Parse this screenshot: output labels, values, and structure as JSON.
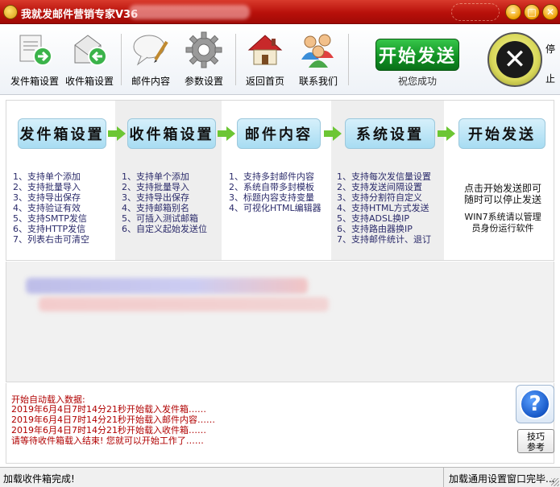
{
  "window": {
    "title": "我就发邮件营销专家V36",
    "buttons": {
      "minimize": "–",
      "maximize": "□",
      "close": "✕"
    }
  },
  "toolbar": {
    "items": [
      {
        "label": "发件箱设置",
        "icon": "sender-envelope-icon"
      },
      {
        "label": "收件箱设置",
        "icon": "inbox-envelope-icon"
      },
      {
        "label": "邮件内容",
        "icon": "speech-bubble-pen-icon"
      },
      {
        "label": "参数设置",
        "icon": "gear-icon"
      },
      {
        "label": "返回首页",
        "icon": "home-icon"
      },
      {
        "label": "联系我们",
        "icon": "people-icon"
      }
    ],
    "start": {
      "label": "开始发送",
      "subtitle": "祝您成功"
    },
    "stop": {
      "label_top": "停",
      "label_bottom": "止",
      "icon": "x-icon"
    }
  },
  "flow": {
    "steps": [
      {
        "title": "发件箱设置",
        "items": [
          "1、支持单个添加",
          "2、支持批量导入",
          "3、支持导出保存",
          "4、支持验证有效",
          "5、支持SMTP发信",
          "6、支持HTTP发信",
          "7、列表右击可清空"
        ]
      },
      {
        "title": "收件箱设置",
        "items": [
          "1、支持单个添加",
          "2、支持批量导入",
          "3、支持导出保存",
          "4、支持邮箱别名",
          "5、可插入测试邮箱",
          "6、自定义起始发送位"
        ]
      },
      {
        "title": "邮件内容",
        "items": [
          "1、支持多封邮件内容",
          "2、系统自带多封模板",
          "3、标题内容支持变量",
          "4、可视化HTML编辑器"
        ]
      },
      {
        "title": "系统设置",
        "items": [
          "1、支持每次发信量设置",
          "2、支持发送间隔设置",
          "3、支持分割符自定义",
          "4、支持HTML方式发送",
          "5、支持ADSL换IP",
          "6、支持路由器换IP",
          "7、支持邮件统计、退订"
        ]
      },
      {
        "title": "开始发送",
        "notes": [
          "点击开始发送即可",
          "随时可以停止发送",
          "WIN7系统请以管理",
          "员身份运行软件"
        ]
      }
    ]
  },
  "log": {
    "header": "开始自动载入数据:",
    "lines": [
      "2019年6月4日7时14分21秒开始载入发件箱……",
      "2019年6月4日7时14分21秒开始载入邮件内容……",
      "2019年6月4日7时14分21秒开始载入收件箱……",
      "请等待收件箱载入结束! 您就可以开始工作了……"
    ]
  },
  "help": {
    "icon": "question-icon",
    "tips_label_1": "技巧",
    "tips_label_2": "参考"
  },
  "status": {
    "left": "加载收件箱完成!",
    "right": "加载通用设置窗口完毕..."
  }
}
